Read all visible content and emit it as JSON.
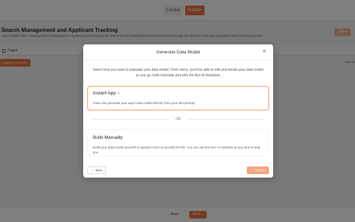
{
  "topbar": {
    "tabs": [
      {
        "label": "Library",
        "active": false
      },
      {
        "label": "Builder",
        "active": true
      }
    ]
  },
  "page": {
    "title": "Search Management and Applicant Tracking",
    "subtitle": "cutive search firm, including client management, invoicing and managing the search for job candidates and tracking them through the entirety of the job application and interview process.",
    "save_label": "Save",
    "pages_label": "Pages",
    "suggest_label": "Suggest modules",
    "right_hint": "Hide Fe"
  },
  "bottombar": {
    "back_label": "Back",
    "next_label": "Next"
  },
  "modal": {
    "title": "Generate Data Model",
    "description": "Select how you want to populate your data model. Don't worry, you'll be able to edit and iterate your data model as you go, both manually and with the Aire AI Assistant.",
    "options": [
      {
        "title": "Instant App",
        "description": "Have Aire generate your app's data model directly from your text prompt."
      },
      {
        "title": "Build Manually",
        "description": "Build your data model yourself or upload it from an Excel/CSV file. You can use the Aire AI Assistant at any time to help you."
      }
    ],
    "or_label": "OR",
    "back_label": "Back",
    "confirm_label": "Confirm"
  },
  "colors": {
    "accent": "#e8743b"
  },
  "icons": [
    "close-icon",
    "sparkle-icon",
    "arrow-left-icon",
    "check-icon",
    "pages-icon",
    "chevron-right-icon"
  ]
}
